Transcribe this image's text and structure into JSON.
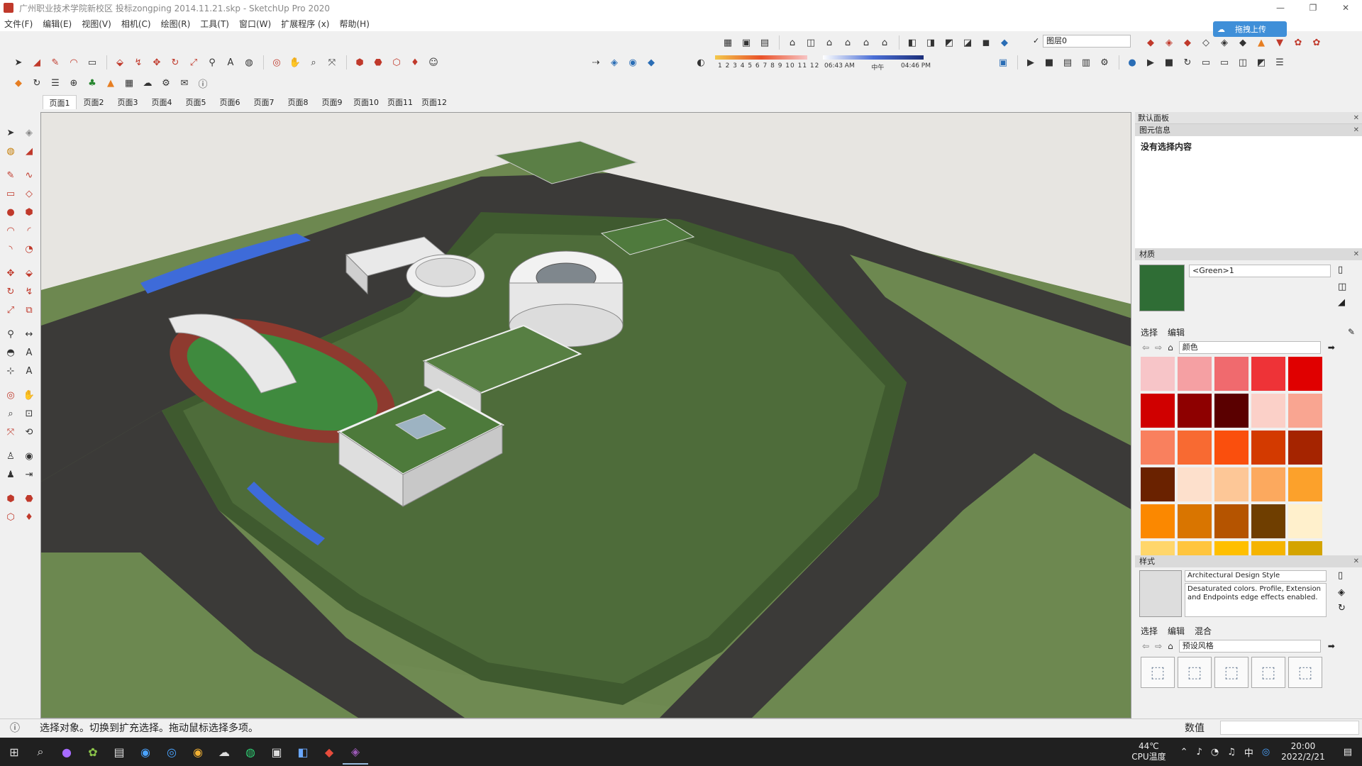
{
  "window": {
    "title": "广州职业技术学院新校区 投标zongping 2014.11.21.skp - SketchUp Pro 2020",
    "minimize": "—",
    "maximize": "❐",
    "close": "✕"
  },
  "menu": [
    "文件(F)",
    "编辑(E)",
    "视图(V)",
    "相机(C)",
    "绘图(R)",
    "工具(T)",
    "窗口(W)",
    "扩展程序 (x)",
    "帮助(H)"
  ],
  "layer": {
    "check": "✓",
    "name": "图层0"
  },
  "upload_button": "拖拽上传",
  "shadow": {
    "months": "1 2 3 4 5 6 7 8 9 10 11 12",
    "time_start": "06:43 AM",
    "time_mid": "中午",
    "time_end": "04:46 PM"
  },
  "scenes": [
    "页面1",
    "页面2",
    "页面3",
    "页面4",
    "页面5",
    "页面6",
    "页面7",
    "页面8",
    "页面9",
    "页面10",
    "页面11",
    "页面12"
  ],
  "tray": {
    "title": "默认面板",
    "entity_info": {
      "header": "图元信息",
      "text": "没有选择内容"
    },
    "materials": {
      "header": "材质",
      "name": "<Green>1",
      "tab_select": "选择",
      "tab_edit": "编辑",
      "collection": "颜色",
      "swatches": [
        "#f7c5c8",
        "#f5a0a3",
        "#f06a6e",
        "#ee3337",
        "#e00000",
        "#d00000",
        "#8e0000",
        "#5a0000",
        "#fbd0c8",
        "#f9a591",
        "#f9805e",
        "#f86a32",
        "#fa4f0d",
        "#d33a00",
        "#a52400",
        "#6a2200",
        "#fde0cc",
        "#fdc797",
        "#fca95e",
        "#fca12b",
        "#fb8800",
        "#d97500",
        "#b55400",
        "#6f3e00",
        "#fff0cc",
        "#ffd66b",
        "#ffc53e",
        "#ffbf00",
        "#f5b400",
        "#d4a400"
      ]
    },
    "styles": {
      "header": "样式",
      "name": "Architectural Design Style",
      "description": "Desaturated colors. Profile, Extension and Endpoints edge effects enabled.",
      "tab_select": "选择",
      "tab_edit": "编辑",
      "tab_mix": "混合",
      "collection": "预设风格"
    }
  },
  "status": {
    "message": "选择对象。切换到扩充选择。拖动鼠标选择多项。",
    "measure_label": "数值"
  },
  "taskbar": {
    "cpu_temp": "44℃",
    "cpu_label": "CPU温度",
    "ime": "中",
    "time": "20:00",
    "date": "2022/2/21"
  }
}
